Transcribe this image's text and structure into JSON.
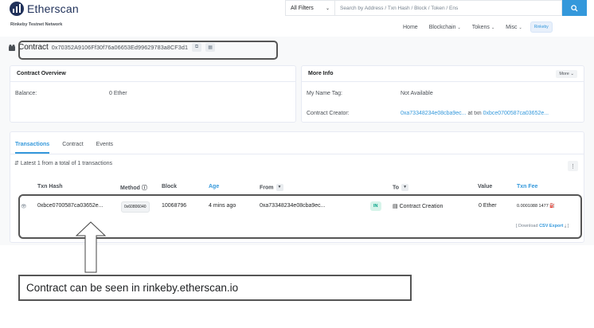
{
  "header": {
    "logo_text": "Etherscan",
    "network": "Rinkeby Testnet Network",
    "filter_label": "All Filters",
    "search_placeholder": "Search by Address / Txn Hash / Block / Token / Ens",
    "search_icon": "search-icon",
    "nav": [
      {
        "label": "Home",
        "caret": ""
      },
      {
        "label": "Blockchain",
        "caret": "⌄"
      },
      {
        "label": "Tokens",
        "caret": "⌄"
      },
      {
        "label": "Misc",
        "caret": "⌄"
      }
    ],
    "network_badge": "Rinkeby"
  },
  "title": {
    "label": "Contract",
    "address": "0x70352A9106Ff30f76a06653Ed99629783a8CF3d1"
  },
  "overview": {
    "heading": "Contract Overview",
    "balance_label": "Balance:",
    "balance_value": "0 Ether"
  },
  "more_info": {
    "heading": "More Info",
    "more_button": "More ⌄",
    "name_tag_label": "My Name Tag:",
    "name_tag_value": "Not Available",
    "creator_label": "Contract Creator:",
    "creator_address": "0xa73348234e08cba9ec...",
    "creator_at": "at txn",
    "creator_txn": "0xbce0700587ca03652e..."
  },
  "tabs": [
    "Transactions",
    "Contract",
    "Events"
  ],
  "latest_text": "Latest 1 from a total of 1 transactions",
  "table": {
    "headers": {
      "txn_hash": "Txn Hash",
      "method": "Method ⓘ",
      "block": "Block",
      "age": "Age",
      "from": "From",
      "to": "To",
      "value": "Value",
      "fee": "Txn Fee"
    },
    "rows": [
      {
        "txn_hash": "0xbce0700587ca03652e...",
        "method": "0x60806040",
        "block": "10068796",
        "age": "4 mins ago",
        "from": "0xa73348234e08cba9ec...",
        "direction": "IN",
        "to": "Contract Creation",
        "value": "0 Ether",
        "fee": "0.0001088 1477"
      }
    ],
    "download_prefix": "[ Download",
    "download_link": "CSV Export",
    "download_suffix": "⤓ ]"
  },
  "caption": "Contract can be seen in rinkeby.etherscan.io",
  "colors": {
    "brand": "#21325b",
    "link": "#3498db",
    "in_badge_bg": "#d7f4ea",
    "in_badge_text": "#00a186"
  }
}
